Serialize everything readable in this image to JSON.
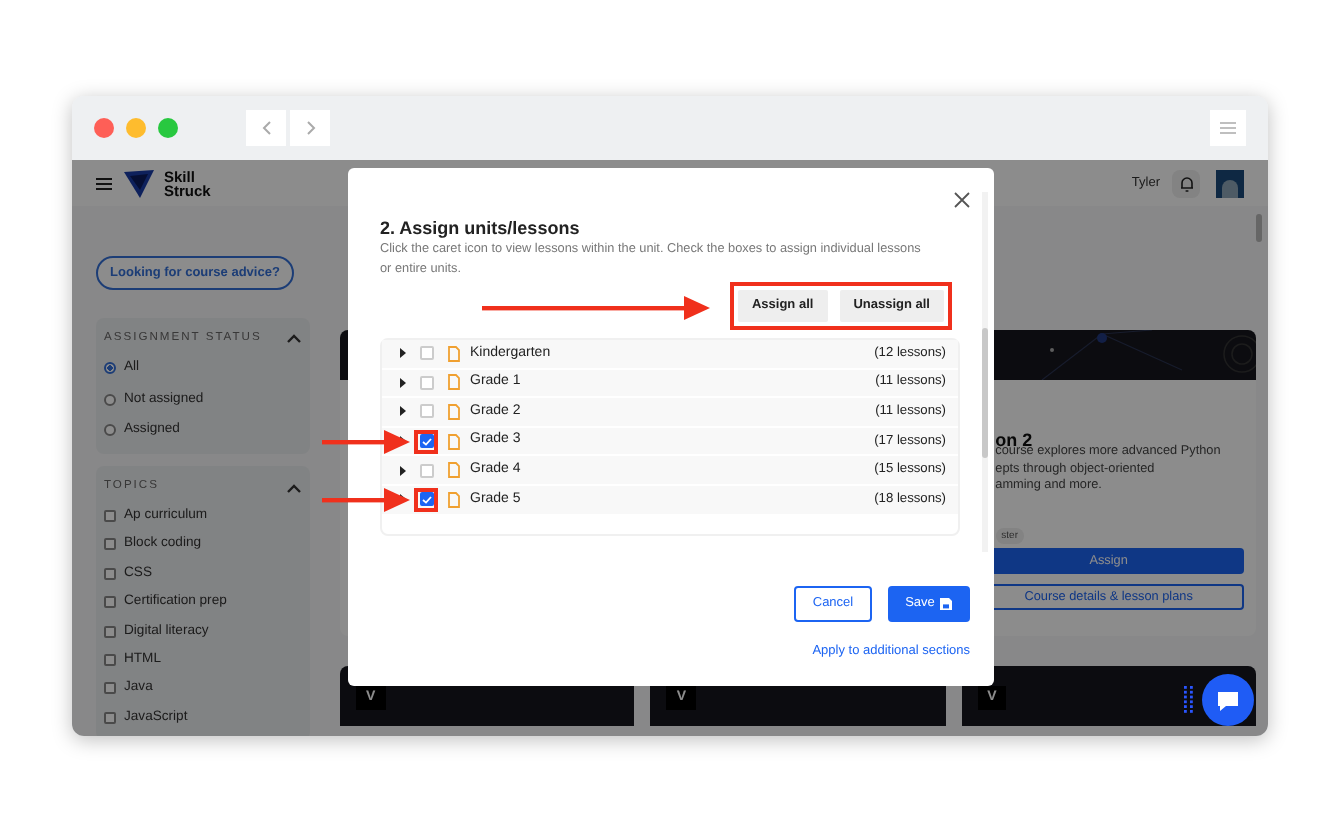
{
  "app": {
    "brand_line_1": "Skill",
    "brand_line_2": "Struck",
    "user": "Tyler"
  },
  "sidebar": {
    "advice_button": "Looking for course advice?",
    "sections": [
      {
        "title": "ASSIGNMENT STATUS",
        "kind": "radio",
        "expanded": true,
        "options": [
          {
            "label": "All",
            "selected": true
          },
          {
            "label": "Not assigned",
            "selected": false
          },
          {
            "label": "Assigned",
            "selected": false
          }
        ]
      },
      {
        "title": "TOPICS",
        "kind": "checkbox",
        "expanded": true,
        "options": [
          {
            "label": "Ap curriculum",
            "checked": false
          },
          {
            "label": "Block coding",
            "checked": false
          },
          {
            "label": "CSS",
            "checked": false
          },
          {
            "label": "Certification prep",
            "checked": false
          },
          {
            "label": "Digital literacy",
            "checked": false
          },
          {
            "label": "HTML",
            "checked": false
          },
          {
            "label": "Java",
            "checked": false
          },
          {
            "label": "JavaScript",
            "checked": false
          }
        ]
      }
    ]
  },
  "course_cards": [
    {
      "title": "on 2",
      "description": [
        "course explores more advanced Python",
        "epts through object-oriented",
        "amming and more."
      ],
      "tag": "ster",
      "buttons": [
        "Assign",
        "Course details & lesson plans"
      ]
    }
  ],
  "lower_cards": [
    {
      "badge": "V"
    },
    {
      "badge": "V"
    },
    {
      "badge": "V"
    }
  ],
  "modal": {
    "title": "2. Assign units/lessons",
    "description": "Click the caret icon to view lessons within the unit. Check the boxes to assign individual lessons or entire units.",
    "bulk_actions": {
      "highlighted": true,
      "buttons": [
        "Assign all",
        "Unassign all"
      ]
    },
    "units": [
      {
        "name": "Kindergarten",
        "count": "(12 lessons)",
        "checked": false,
        "highlighted": false
      },
      {
        "name": "Grade 1",
        "count": "(11 lessons)",
        "checked": false,
        "highlighted": false
      },
      {
        "name": "Grade 2",
        "count": "(11 lessons)",
        "checked": false,
        "highlighted": false
      },
      {
        "name": "Grade 3",
        "count": "(17 lessons)",
        "checked": true,
        "highlighted": true
      },
      {
        "name": "Grade 4",
        "count": "(15 lessons)",
        "checked": false,
        "highlighted": false
      },
      {
        "name": "Grade 5",
        "count": "(18 lessons)",
        "checked": true,
        "highlighted": true
      }
    ],
    "cancel": "Cancel",
    "save": "Save",
    "link": "Apply to additional sections"
  }
}
